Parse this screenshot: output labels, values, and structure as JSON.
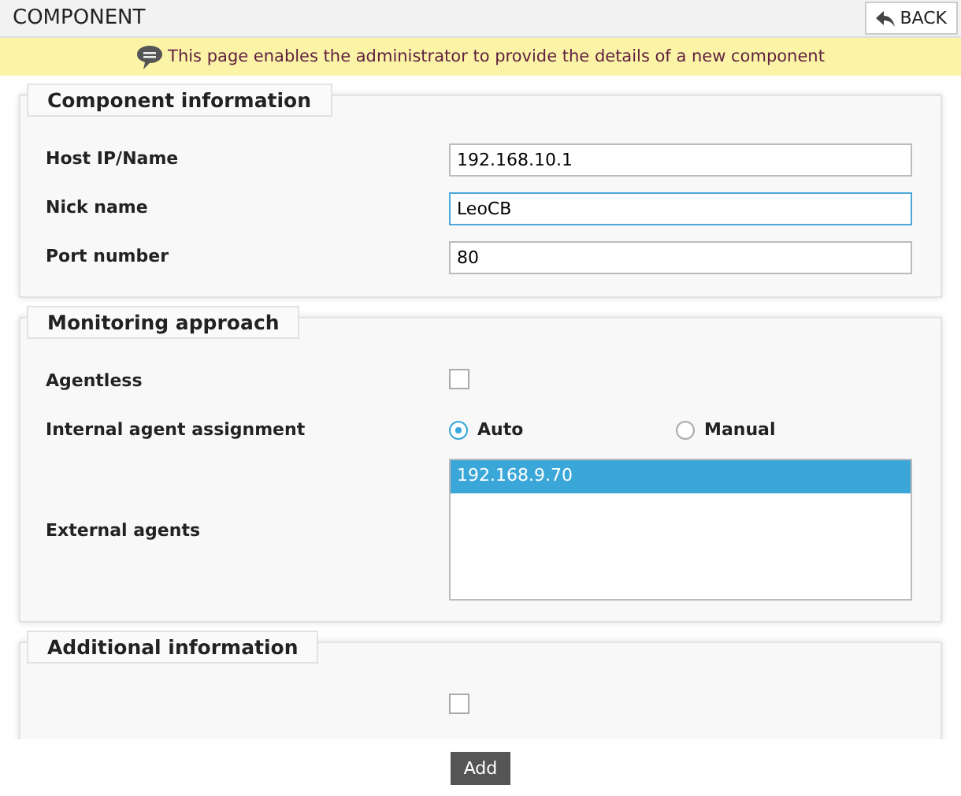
{
  "header": {
    "title": "COMPONENT",
    "back_button": "BACK"
  },
  "banner": {
    "text": "This page enables the administrator to provide the details of a new component"
  },
  "sections": [
    {
      "title": "Component information",
      "rows": [
        {
          "kind": "text",
          "label": "Host IP/Name",
          "value": "192.168.10.1",
          "focused": false
        },
        {
          "kind": "text",
          "label": "Nick name",
          "value": "LeoCB",
          "focused": true
        },
        {
          "kind": "text",
          "label": "Port number",
          "value": "80",
          "focused": false
        }
      ]
    },
    {
      "title": "Monitoring approach",
      "rows": [
        {
          "kind": "checkbox",
          "label": "Agentless",
          "checked": false
        },
        {
          "kind": "radio",
          "label": "Internal agent assignment",
          "options": [
            {
              "label": "Auto",
              "selected": true
            },
            {
              "label": "Manual",
              "selected": false
            }
          ]
        },
        {
          "kind": "listbox",
          "label": "External agents",
          "items": [
            {
              "label": "192.168.9.70",
              "selected": true
            }
          ]
        }
      ]
    },
    {
      "title": "Additional information",
      "rows": [
        {
          "kind": "checkbox",
          "checked": false
        }
      ]
    }
  ],
  "add_button": "Add"
}
